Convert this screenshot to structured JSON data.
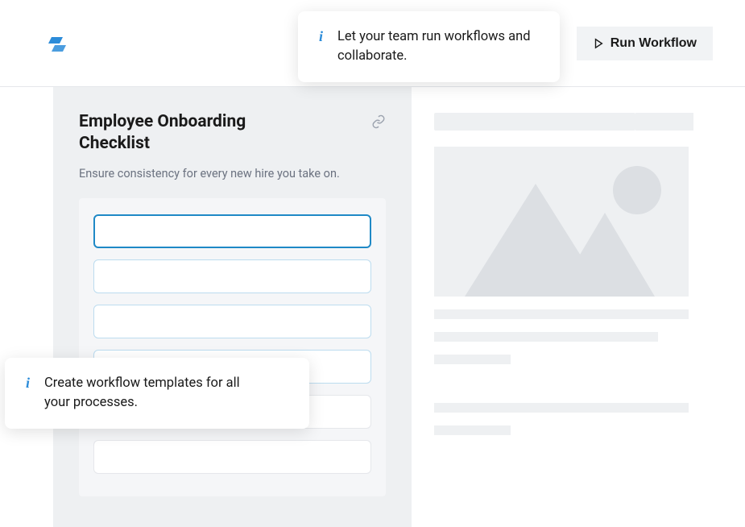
{
  "header": {
    "run_button": "Run Workflow"
  },
  "sidebar": {
    "title": "Employee Onboarding Checklist",
    "subtitle": "Ensure consistency for every new hire you take on."
  },
  "tooltips": {
    "top": "Let your team run workflows and collaborate.",
    "left": "Create workflow templates for all your processes."
  }
}
